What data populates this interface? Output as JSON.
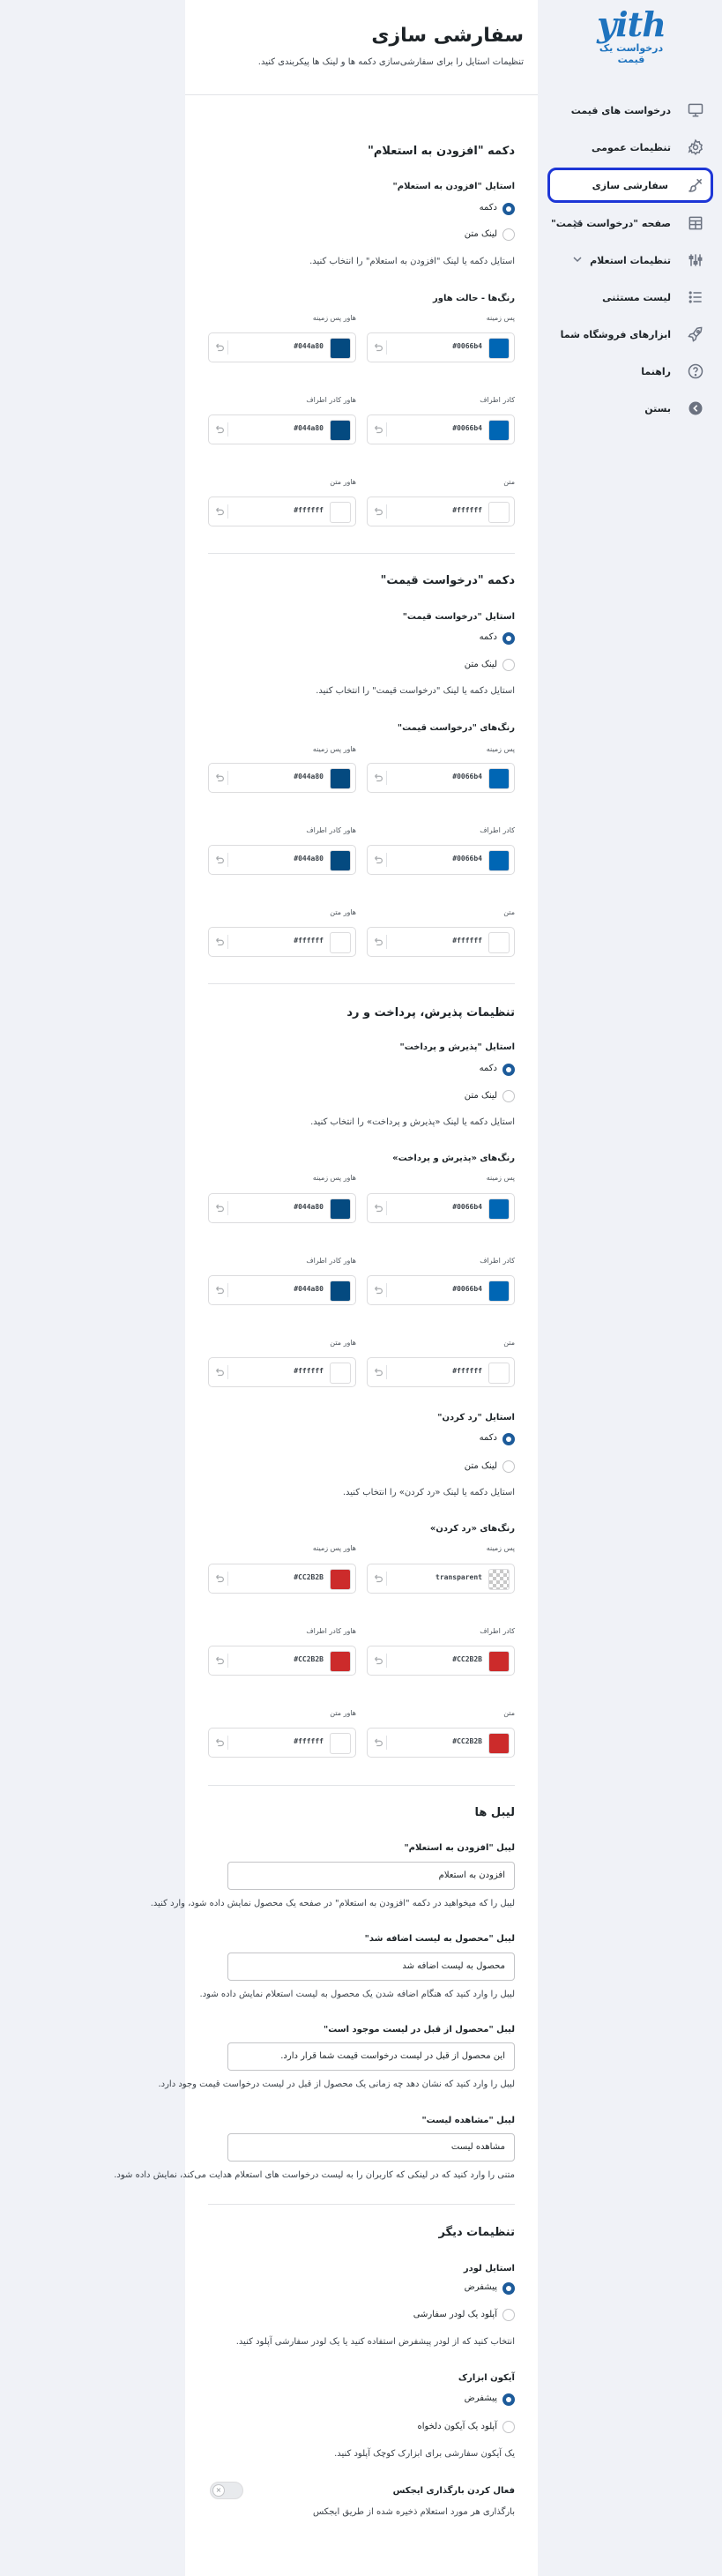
{
  "brand": {
    "logo": "yith",
    "subtitle": "درخواست یک قیمت"
  },
  "nav": [
    {
      "label": "درخواست های قیمت",
      "icon": "monitor-icon"
    },
    {
      "label": "تنظیمات عمومی",
      "icon": "gear-icon"
    },
    {
      "label": "سفارشی سازی",
      "icon": "brush-icon",
      "active": true
    },
    {
      "label": "صفحه \"درخواست قیمت\"",
      "icon": "layout-icon",
      "chevron": true
    },
    {
      "label": "تنظیمات استعلام",
      "icon": "sliders-icon",
      "chevron": true
    },
    {
      "label": "لیست مستثنی",
      "icon": "list-icon"
    },
    {
      "label": "ابزارهای فروشگاه شما",
      "icon": "rocket-icon"
    },
    {
      "label": "راهنما",
      "icon": "help-icon"
    },
    {
      "label": "بستن",
      "icon": "close-circle-icon"
    }
  ],
  "header": {
    "title": "سفارشی سازی",
    "desc": "تنظیمات استایل را برای سفارشی‌سازی دکمه ها و لینک ها پیکربندی کنید."
  },
  "common": {
    "button": "دکمه",
    "text_link": "لینک متن",
    "bg": "پس زمینه",
    "bg_hover": "هاور پس زمینه",
    "border": "کادر اطراف",
    "border_hover": "هاور کادر اطراف",
    "text": "متن",
    "text_hover": "هاور متن"
  },
  "add_quote": {
    "title": "دکمه \"افزودن به استعلام\"",
    "style_label": "استایل \"افزودن به استعلام\"",
    "style_desc": "استایل دکمه یا لینک \"افزودن به استعلام\" را انتخاب کنید.",
    "colors_label": "رنگ‌ها - حالت هاور",
    "bg": "#0066b4",
    "bg_hover": "#044a80",
    "border": "#0066b4",
    "border_hover": "#044a80",
    "text": "#ffffff",
    "text_hover": "#ffffff"
  },
  "request_quote": {
    "title": "دکمه \"درخواست قیمت\"",
    "style_label": "استایل \"درخواست قیمت\"",
    "style_desc": "استایل دکمه یا لینک \"درخواست قیمت\" را انتخاب کنید.",
    "colors_label": "رنگ‌های \"درخواست قیمت\"",
    "bg": "#0066b4",
    "bg_hover": "#044a80",
    "border": "#0066b4",
    "border_hover": "#044a80",
    "text": "#ffffff",
    "text_hover": "#ffffff"
  },
  "accept": {
    "title": "تنظیمات پذیرش، پرداخت و رد",
    "style_label": "استایل \"پذیرش و پرداخت\"",
    "style_desc": "استایل دکمه یا لینک «پذیرش و پرداخت» را انتخاب کنید.",
    "colors_label": "رنگ‌های «پذیرش و پرداخت»",
    "bg": "#0066b4",
    "bg_hover": "#044a80",
    "border": "#0066b4",
    "border_hover": "#044a80",
    "text": "#ffffff",
    "text_hover": "#ffffff"
  },
  "reject": {
    "style_label": "استایل \"رد کردن\"",
    "style_desc": "استایل دکمه یا لینک «رد کردن» را انتخاب کنید.",
    "colors_label": "رنگ‌های «رد کردن»",
    "bg": "transparent",
    "bg_hover": "#CC2B2B",
    "border": "#CC2B2B",
    "border_hover": "#CC2B2B",
    "text": "#CC2B2B",
    "text_hover": "#ffffff"
  },
  "labels": {
    "title": "لیبل ها",
    "add_label": "لیبل \"افزودن به استعلام\"",
    "add_value": "افزودن به استعلام",
    "add_desc": "لیبل را که میخواهید در دکمه \"افزودن به استعلام\" در صفحه یک محصول نمایش داده شود، وارد کنید.",
    "added_label": "لیبل \"محصول به لیست اضافه شد\"",
    "added_value": "محصول به لیست اضافه شد",
    "added_desc": "لیبل را وارد کنید که هنگام اضافه شدن یک محصول به لیست استعلام نمایش داده شود.",
    "exists_label": "لیبل \"محصول از قبل در لیست موجود است\"",
    "exists_value": "این محصول از قبل در لیست درخواست قیمت شما قرار دارد.",
    "exists_desc": "لیبل را وارد کنید که نشان دهد چه زمانی یک محصول از قبل در لیست درخواست قیمت وجود دارد.",
    "view_label": "لیبل \"مشاهده لیست\"",
    "view_value": "مشاهده لیست",
    "view_desc": "متنی را وارد کنید که در لینکی که کاربران را به لیست درخواست های استعلام هدایت می‌کند، نمایش داده شود."
  },
  "other": {
    "title": "تنظیمات دیگر",
    "loader_label": "استایل لودر",
    "loader_default": "پیشفرض",
    "loader_custom": "آپلود یک لودر سفارشی",
    "loader_desc": "انتخاب کنید که از لودر پیشفرض استفاده کنید یا یک لودر سفارشی آپلود کنید.",
    "icon_label": "آیکون ابزارک",
    "icon_default": "پیشفرض",
    "icon_custom": "آپلود یک آیکون دلخواه",
    "icon_desc": "یک آیکون سفارشی برای ابزارک کوچک آپلود کنید.",
    "ajax_label": "فعال کردن بارگذاری ایجکس",
    "ajax_desc": "بارگذاری هر مورد استعلام ذخیره شده از طریق ایجکس",
    "toggle_mark": "×"
  }
}
